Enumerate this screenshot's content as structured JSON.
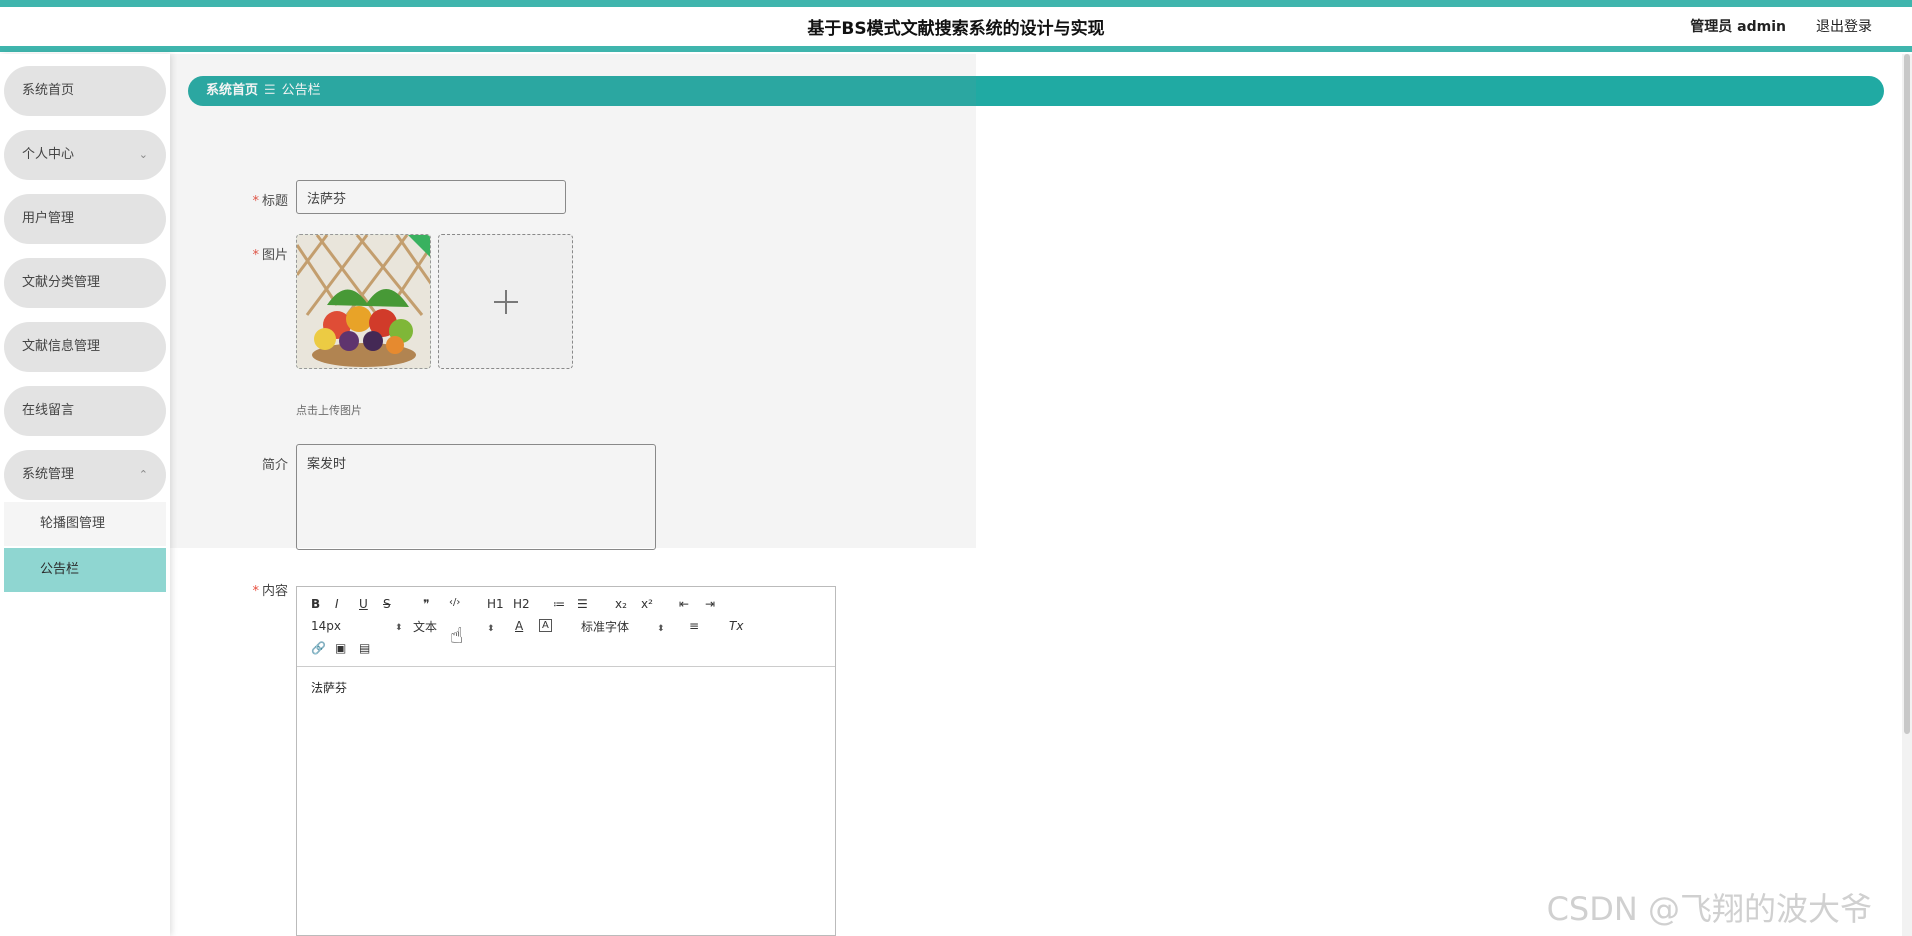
{
  "header": {
    "title": "基于BS模式文献搜索系统的设计与实现",
    "user": "管理员 admin",
    "logout": "退出登录"
  },
  "sidebar": {
    "items": [
      {
        "label": "系统首页"
      },
      {
        "label": "个人中心"
      },
      {
        "label": "用户管理"
      },
      {
        "label": "文献分类管理"
      },
      {
        "label": "文献信息管理"
      },
      {
        "label": "在线留言"
      },
      {
        "label": "系统管理"
      }
    ],
    "sub_items": [
      {
        "label": "轮播图管理"
      },
      {
        "label": "公告栏"
      }
    ]
  },
  "breadcrumb": {
    "home": "系统首页",
    "separator": "☰",
    "current": "公告栏"
  },
  "form": {
    "title_label": "标题",
    "title_value": "法萨芬",
    "image_label": "图片",
    "upload_hint": "点击上传图片",
    "intro_label": "简介",
    "intro_value": "案发时",
    "content_label": "内容"
  },
  "editor": {
    "toolbar": {
      "bold": "B",
      "italic": "I",
      "underline": "U",
      "strike": "S",
      "quote": "❞",
      "code": "‹/›",
      "h1": "H1",
      "h2": "H2",
      "ol": "≔",
      "ul": "☰",
      "sub": "x₂",
      "sup": "x²",
      "outdent": "⇤",
      "indent": "⇥",
      "size": "14px",
      "header": "文本",
      "color": "A",
      "bg": "A",
      "font": "标准字体",
      "align": "≡",
      "clean": "Tx",
      "link": "🔗",
      "image": "▣",
      "video": "▤"
    },
    "content": "法萨芬"
  },
  "watermark": "CSDN @飞翔的波大爷"
}
